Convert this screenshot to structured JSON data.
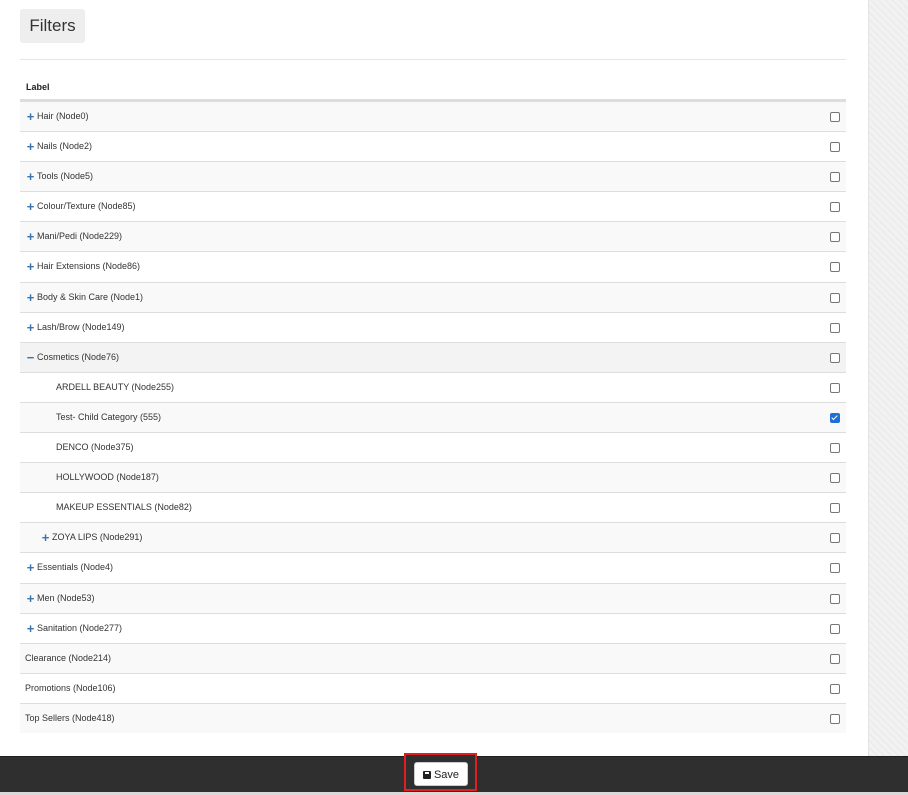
{
  "header": {
    "title": "Filters"
  },
  "table": {
    "column_label": "Label",
    "rows": [
      {
        "toggle": "+",
        "label": "Hair (Node0)",
        "checked": false,
        "level": 0
      },
      {
        "toggle": "+",
        "label": "Nails (Node2)",
        "checked": false,
        "level": 0
      },
      {
        "toggle": "+",
        "label": "Tools (Node5)",
        "checked": false,
        "level": 0
      },
      {
        "toggle": "+",
        "label": "Colour/Texture (Node85)",
        "checked": false,
        "level": 0
      },
      {
        "toggle": "+",
        "label": "Mani/Pedi (Node229)",
        "checked": false,
        "level": 0
      },
      {
        "toggle": "+",
        "label": "Hair Extensions (Node86)",
        "checked": false,
        "level": 0
      },
      {
        "toggle": "+",
        "label": "Body & Skin Care (Node1)",
        "checked": false,
        "level": 0
      },
      {
        "toggle": "+",
        "label": "Lash/Brow (Node149)",
        "checked": false,
        "level": 0
      },
      {
        "toggle": "−",
        "label": "Cosmetics (Node76)",
        "checked": false,
        "level": 0
      },
      {
        "toggle": "",
        "label": "ARDELL BEAUTY (Node255)",
        "checked": false,
        "level": 1
      },
      {
        "toggle": "",
        "label": "Test- Child Category (555)",
        "checked": true,
        "level": 1
      },
      {
        "toggle": "",
        "label": "DENCO (Node375)",
        "checked": false,
        "level": 1
      },
      {
        "toggle": "",
        "label": "HOLLYWOOD (Node187)",
        "checked": false,
        "level": 1
      },
      {
        "toggle": "",
        "label": "MAKEUP ESSENTIALS (Node82)",
        "checked": false,
        "level": 1
      },
      {
        "toggle": "+",
        "label": "ZOYA LIPS (Node291)",
        "checked": false,
        "level": 1
      },
      {
        "toggle": "+",
        "label": "Essentials (Node4)",
        "checked": false,
        "level": 0
      },
      {
        "toggle": "+",
        "label": "Men (Node53)",
        "checked": false,
        "level": 0
      },
      {
        "toggle": "+",
        "label": "Sanitation (Node277)",
        "checked": false,
        "level": 0
      },
      {
        "toggle": "",
        "label": "Clearance (Node214)",
        "checked": false,
        "level": 0
      },
      {
        "toggle": "",
        "label": "Promotions (Node106)",
        "checked": false,
        "level": 0
      },
      {
        "toggle": "",
        "label": "Top Sellers (Node418)",
        "checked": false,
        "level": 0
      }
    ]
  },
  "footer": {
    "save_label": "Save",
    "save_icon": "floppy-disk-icon"
  },
  "colors": {
    "toggle": "#3a75b0",
    "checked": "#1e6fd9",
    "highlight": "#e02020",
    "footer_bg": "#2f2f2f"
  }
}
